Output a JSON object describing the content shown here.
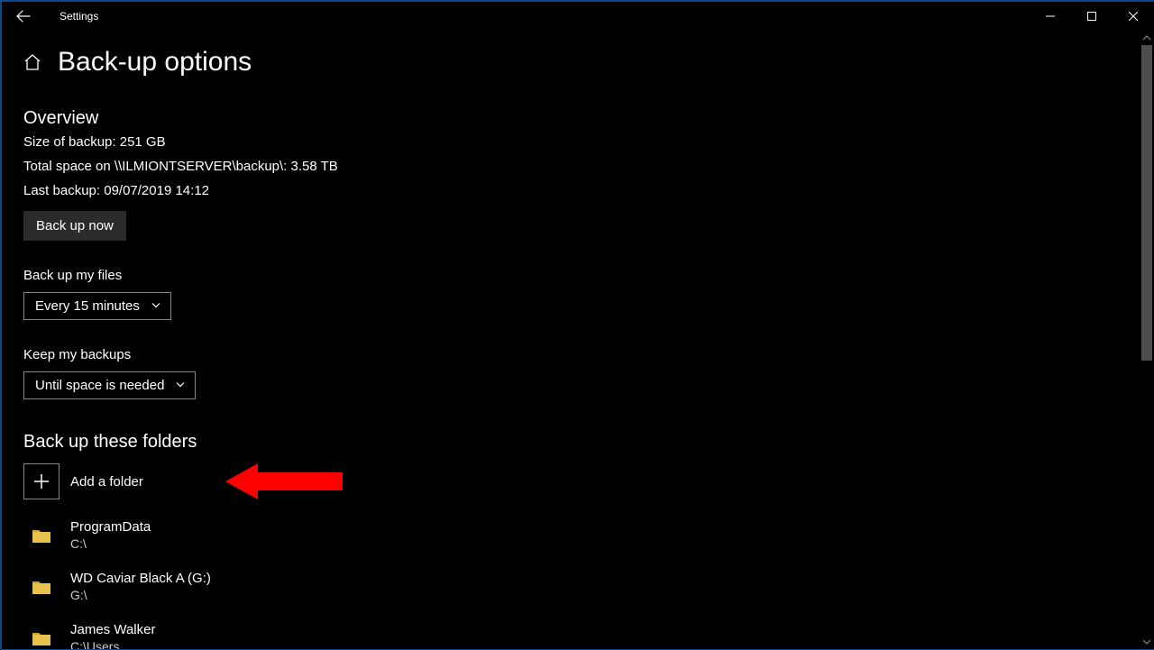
{
  "window": {
    "title": "Settings"
  },
  "page": {
    "title": "Back-up options"
  },
  "overview": {
    "heading": "Overview",
    "size_line": "Size of backup: 251 GB",
    "total_space_line": "Total space on \\\\ILMIONTSERVER\\backup\\: 3.58 TB",
    "last_backup_line": "Last backup: 09/07/2019 14:12",
    "backup_now_label": "Back up now"
  },
  "frequency": {
    "label": "Back up my files",
    "value": "Every 15 minutes"
  },
  "retention": {
    "label": "Keep my backups",
    "value": "Until space is needed"
  },
  "folders": {
    "heading": "Back up these folders",
    "add_label": "Add a folder",
    "items": [
      {
        "name": "ProgramData",
        "path": "C:\\"
      },
      {
        "name": "WD Caviar Black A (G:)",
        "path": "G:\\"
      },
      {
        "name": "James Walker",
        "path": "C:\\Users"
      }
    ]
  }
}
